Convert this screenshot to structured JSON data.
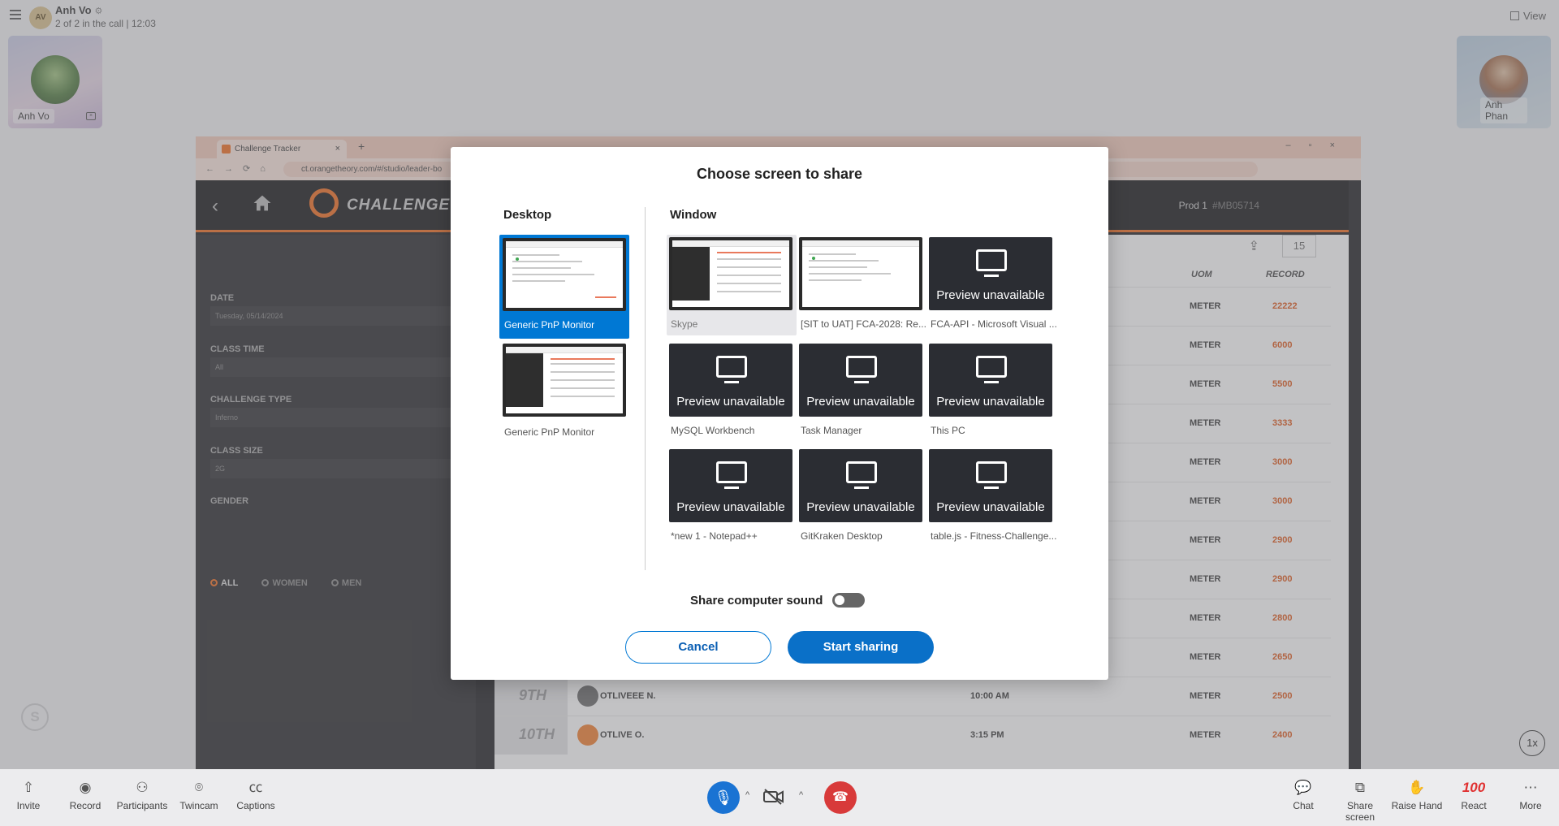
{
  "call": {
    "avatar_initials": "AV",
    "name": "Anh Vo",
    "status": "2 of 2 in the call | 12:03",
    "view_label": "View",
    "participants": [
      {
        "name": "Anh Vo"
      },
      {
        "name": "Anh Phan"
      }
    ]
  },
  "browser": {
    "tab_title": "Challenge Tracker",
    "url": "ct.orangetheory.com/#/studio/leader-bo",
    "app_title": "CHALLENGE TRAC",
    "prod_label": "Prod 1",
    "prod_id": "#MB05714",
    "page_size": "15"
  },
  "filters": {
    "date_label": "DATE",
    "date_value": "Tuesday, 05/14/2024",
    "class_time_label": "CLASS TIME",
    "class_time_value": "All",
    "challenge_type_label": "CHALLENGE TYPE",
    "challenge_type_value": "Inferno",
    "class_size_label": "CLASS SIZE",
    "class_size_value": "2G",
    "gender_label": "GENDER",
    "gender_options": [
      "ALL",
      "WOMEN",
      "MEN"
    ]
  },
  "leaderboard": {
    "col_uom": "UOM",
    "col_record": "RECORD",
    "rows": [
      {
        "uom": "METER",
        "record": "22222"
      },
      {
        "uom": "METER",
        "record": "6000"
      },
      {
        "uom": "METER",
        "record": "5500"
      },
      {
        "uom": "METER",
        "record": "3333"
      },
      {
        "uom": "METER",
        "record": "3000"
      },
      {
        "uom": "METER",
        "record": "3000"
      },
      {
        "uom": "METER",
        "record": "2900"
      },
      {
        "uom": "METER",
        "record": "2900"
      },
      {
        "uom": "METER",
        "record": "2800"
      },
      {
        "uom": "METER",
        "record": "2650"
      },
      {
        "rank": "9TH",
        "name": "OTLIVEEE N.",
        "time": "10:00 AM",
        "uom": "METER",
        "record": "2500"
      },
      {
        "rank": "10TH",
        "name": "OTLIVE O.",
        "time": "3:15 PM",
        "uom": "METER",
        "record": "2400"
      }
    ]
  },
  "modal": {
    "title": "Choose screen to share",
    "desktop_label": "Desktop",
    "window_label": "Window",
    "desktop_items": [
      "Generic PnP Monitor",
      "Generic PnP Monitor"
    ],
    "preview_unavailable": "Preview unavailable",
    "window_items": [
      "Skype",
      "[SIT to UAT] FCA-2028: Re...",
      "FCA-API - Microsoft Visual ...",
      "MySQL Workbench",
      "Task Manager",
      "This PC",
      "*new 1 - Notepad++",
      "GitKraken Desktop",
      "table.js - Fitness-Challenge..."
    ],
    "share_sound_label": "Share computer sound",
    "cancel_label": "Cancel",
    "start_label": "Start sharing"
  },
  "controls": {
    "invite": "Invite",
    "record": "Record",
    "participants": "Participants",
    "twincam": "Twincam",
    "captions": "Captions",
    "chat": "Chat",
    "share_screen": "Share screen",
    "raise_hand": "Raise Hand",
    "react": "React",
    "more": "More",
    "speed": "1x"
  }
}
